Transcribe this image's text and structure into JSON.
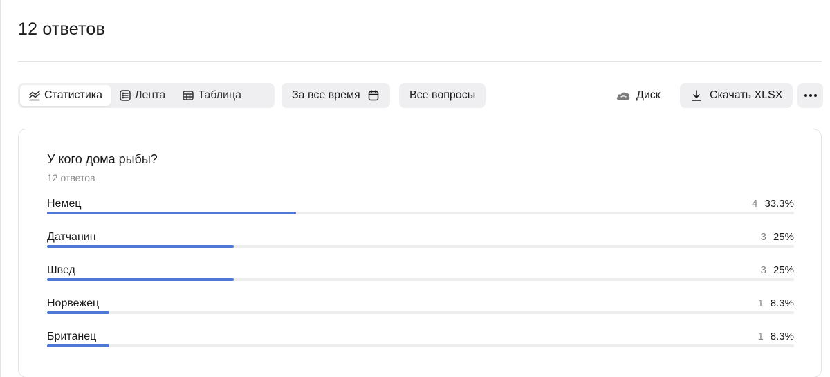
{
  "header": {
    "title": "12 ответов"
  },
  "toolbar": {
    "views": [
      {
        "label": "Статистика",
        "icon": "chart-line-icon",
        "active": true
      },
      {
        "label": "Лента",
        "icon": "list-icon",
        "active": false
      },
      {
        "label": "Таблица",
        "icon": "table-icon",
        "active": false
      }
    ],
    "period_label": "За все время",
    "questions_label": "Все вопросы",
    "disk_label": "Диск",
    "download_label": "Скачать XLSX",
    "more_label": "•••"
  },
  "question": {
    "title": "У кого дома рыбы?",
    "subtitle": "12 ответов",
    "answers": [
      {
        "label": "Немец",
        "count": "4",
        "percent": "33.3%",
        "share": 0.333
      },
      {
        "label": "Датчанин",
        "count": "3",
        "percent": "25%",
        "share": 0.25
      },
      {
        "label": "Швед",
        "count": "3",
        "percent": "25%",
        "share": 0.25
      },
      {
        "label": "Норвежец",
        "count": "1",
        "percent": "8.3%",
        "share": 0.083
      },
      {
        "label": "Британец",
        "count": "1",
        "percent": "8.3%",
        "share": 0.083
      }
    ]
  },
  "colors": {
    "bar_fill": "#4e77d6",
    "bar_track": "#ededed",
    "pill_bg": "#efeff1"
  }
}
